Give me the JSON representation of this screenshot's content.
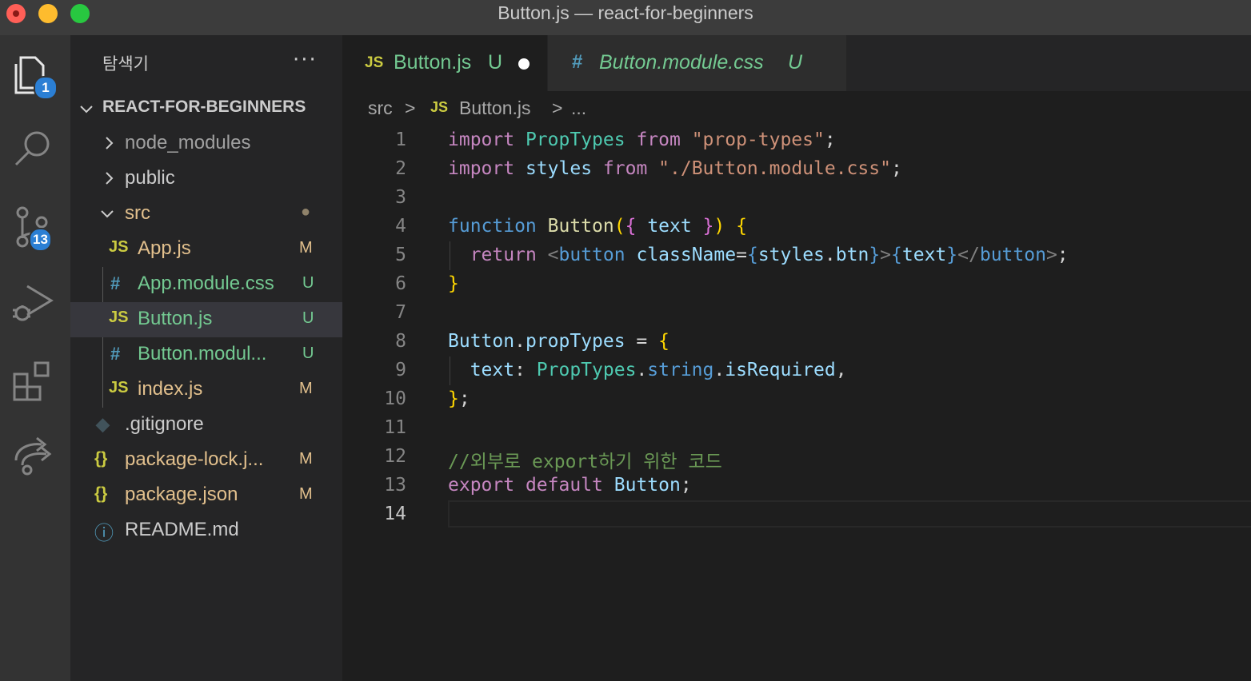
{
  "window": {
    "title": "Button.js — react-for-beginners"
  },
  "activity_bar": {
    "items": [
      {
        "icon": "files-icon",
        "badge": "1"
      },
      {
        "icon": "search-icon",
        "badge": ""
      },
      {
        "icon": "source-control-icon",
        "badge": "13"
      },
      {
        "icon": "run-debug-icon",
        "badge": ""
      },
      {
        "icon": "extensions-icon",
        "badge": ""
      },
      {
        "icon": "remote-share-icon",
        "badge": ""
      }
    ],
    "badge_color": "#2b7fd4"
  },
  "explorer": {
    "title": "탐색기",
    "more": "···",
    "project": "REACT-FOR-BEGINNERS",
    "tree": [
      {
        "label": "node_modules",
        "kind": "folder",
        "expanded": false,
        "status": ""
      },
      {
        "label": "public",
        "kind": "folder",
        "expanded": false,
        "status": ""
      },
      {
        "label": "src",
        "kind": "folder",
        "expanded": true,
        "status": "●"
      },
      {
        "label": "App.js",
        "kind": "js",
        "icon": "JS",
        "status": "M"
      },
      {
        "label": "App.module.css",
        "kind": "css",
        "icon": "#",
        "status": "U"
      },
      {
        "label": "Button.js",
        "kind": "js",
        "icon": "JS",
        "status": "U",
        "selected": true
      },
      {
        "label": "Button.modul...",
        "kind": "css",
        "icon": "#",
        "status": "U"
      },
      {
        "label": "index.js",
        "kind": "js",
        "icon": "JS",
        "status": "M"
      },
      {
        "label": ".gitignore",
        "kind": "git",
        "icon": "◆",
        "status": ""
      },
      {
        "label": "package-lock.j...",
        "kind": "json",
        "icon": "{}",
        "status": "M"
      },
      {
        "label": "package.json",
        "kind": "json",
        "icon": "{}",
        "status": "M"
      },
      {
        "label": "README.md",
        "kind": "info",
        "icon": "ⓘ",
        "status": ""
      }
    ]
  },
  "tabs": [
    {
      "icon": "JS",
      "label": "Button.js",
      "status": "U",
      "active": true,
      "modified": true
    },
    {
      "icon": "#",
      "label": "Button.module.css",
      "status": "U",
      "active": false,
      "modified": false
    }
  ],
  "breadcrumb": {
    "folder": "src",
    "sep": ">",
    "file_icon": "JS",
    "file": "Button.js",
    "rest": "..."
  },
  "code": {
    "line_numbers": [
      "1",
      "2",
      "3",
      "4",
      "5",
      "6",
      "7",
      "8",
      "9",
      "10",
      "11",
      "12",
      "13",
      "14"
    ],
    "current_line": "14",
    "lines": [
      [
        [
          "kw",
          "import"
        ],
        [
          "pn",
          " "
        ],
        [
          "ty",
          "PropTypes"
        ],
        [
          "pn",
          " "
        ],
        [
          "kw",
          "from"
        ],
        [
          "pn",
          " "
        ],
        [
          "st",
          "\"prop-types\""
        ],
        [
          "pn",
          ";"
        ]
      ],
      [
        [
          "kw",
          "import"
        ],
        [
          "pn",
          " "
        ],
        [
          "vr",
          "styles"
        ],
        [
          "pn",
          " "
        ],
        [
          "kw",
          "from"
        ],
        [
          "pn",
          " "
        ],
        [
          "st",
          "\"./Button.module.css\""
        ],
        [
          "pn",
          ";"
        ]
      ],
      [],
      [
        [
          "bl",
          "function"
        ],
        [
          "pn",
          " "
        ],
        [
          "fn",
          "Button"
        ],
        [
          "br1",
          "("
        ],
        [
          "br2",
          "{"
        ],
        [
          "pn",
          " "
        ],
        [
          "vr",
          "text"
        ],
        [
          "pn",
          " "
        ],
        [
          "br2",
          "}"
        ],
        [
          "br1",
          ")"
        ],
        [
          "pn",
          " "
        ],
        [
          "br1",
          "{"
        ]
      ],
      [
        [
          "pn",
          "  "
        ],
        [
          "kw",
          "return"
        ],
        [
          "pn",
          " "
        ],
        [
          "tg",
          "<"
        ],
        [
          "bl",
          "button"
        ],
        [
          "pn",
          " "
        ],
        [
          "vr",
          "className"
        ],
        [
          "pn",
          "="
        ],
        [
          "bl",
          "{"
        ],
        [
          "vr",
          "styles"
        ],
        [
          "pn",
          "."
        ],
        [
          "vr",
          "btn"
        ],
        [
          "bl",
          "}"
        ],
        [
          "tg",
          ">"
        ],
        [
          "bl",
          "{"
        ],
        [
          "vr",
          "text"
        ],
        [
          "bl",
          "}"
        ],
        [
          "tg",
          "</"
        ],
        [
          "bl",
          "button"
        ],
        [
          "tg",
          ">"
        ],
        [
          "pn",
          ";"
        ]
      ],
      [
        [
          "br1",
          "}"
        ]
      ],
      [],
      [
        [
          "vr",
          "Button"
        ],
        [
          "pn",
          "."
        ],
        [
          "vr",
          "propTypes"
        ],
        [
          "pn",
          " = "
        ],
        [
          "br1",
          "{"
        ]
      ],
      [
        [
          "pn",
          "  "
        ],
        [
          "vr",
          "text"
        ],
        [
          "pn",
          ": "
        ],
        [
          "ty",
          "PropTypes"
        ],
        [
          "pn",
          "."
        ],
        [
          "bl",
          "string"
        ],
        [
          "pn",
          "."
        ],
        [
          "vr",
          "isRequired"
        ],
        [
          "pn",
          ","
        ]
      ],
      [
        [
          "br1",
          "}"
        ],
        [
          "pn",
          ";"
        ]
      ],
      [],
      [
        [
          "cm",
          "//외부로 export하기 위한 코드"
        ]
      ],
      [
        [
          "kw",
          "export"
        ],
        [
          "pn",
          " "
        ],
        [
          "kw",
          "default"
        ],
        [
          "pn",
          " "
        ],
        [
          "vr",
          "Button"
        ],
        [
          "pn",
          ";"
        ]
      ],
      []
    ]
  },
  "colors": {
    "js_icon": "#cbcb41",
    "css_icon": "#519aba",
    "untracked": "#73c991",
    "modified": "#e2c08d",
    "folder_text": "#cccccc"
  }
}
